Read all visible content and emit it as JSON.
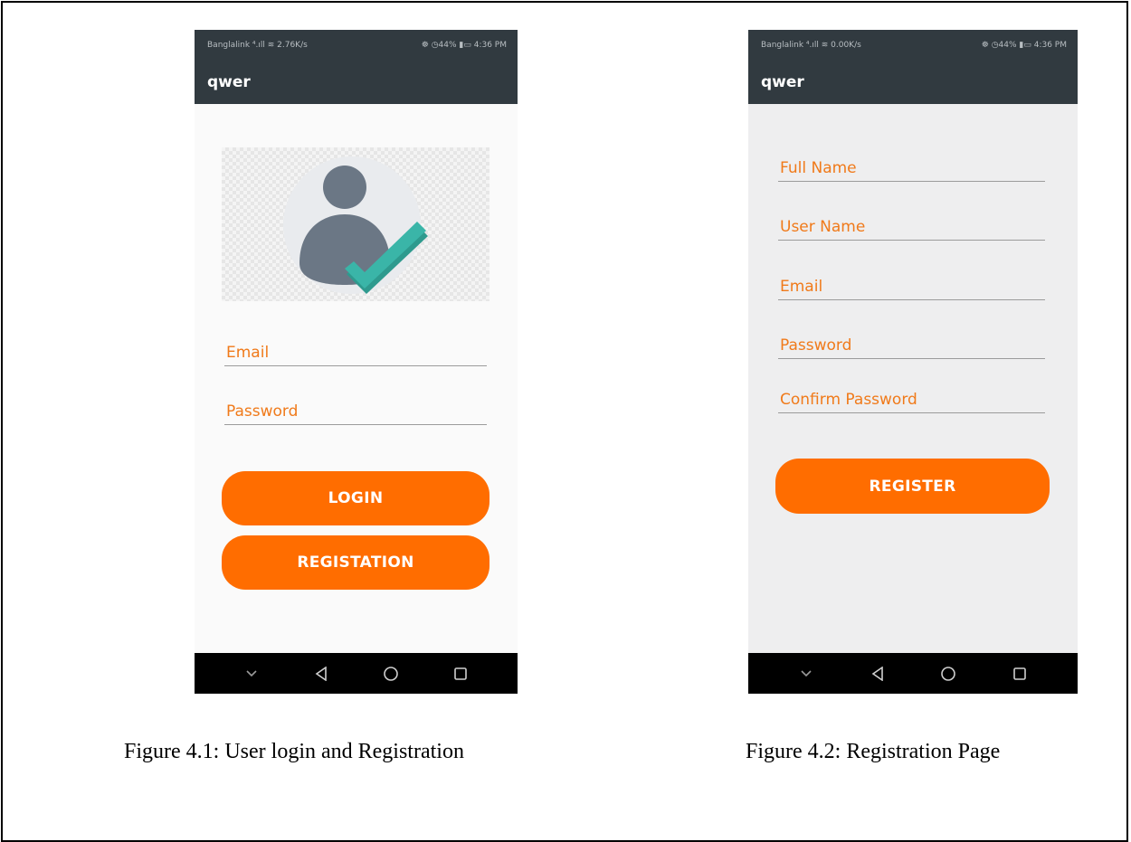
{
  "figure1": {
    "caption": "Figure 4.1: User login and Registration",
    "phone": {
      "status_left": "Banglalink ⁴.ıll ≋ 2.76K/s",
      "status_right": "☸ ◷44% ▮▭ 4:36 PM",
      "app_title": "qwer",
      "avatar_icon": "user-check-avatar",
      "email_placeholder": "Email",
      "password_placeholder": "Password",
      "login_label": "LOGIN",
      "registration_label": "REGISTATION"
    }
  },
  "figure2": {
    "caption": "Figure 4.2: Registration Page",
    "phone": {
      "status_left": "Banglalink ⁴.ıll ≋ 0.00K/s",
      "status_right": "☸ ◷44% ▮▭ 4:36 PM",
      "app_title": "qwer",
      "full_name_placeholder": "Full Name",
      "user_name_placeholder": "User Name",
      "email_placeholder": "Email",
      "password_placeholder": "Password",
      "confirm_password_placeholder": "Confirm Password",
      "register_label": "REGISTER"
    }
  },
  "nav_icons": [
    "chevron-down-icon",
    "back-icon",
    "home-icon",
    "recents-icon"
  ],
  "colors": {
    "app_bar": "#313a40",
    "accent": "#ff6d00",
    "hint_text": "#f07a1a",
    "check": "#3ab5a8",
    "avatar": "#6b7785"
  }
}
